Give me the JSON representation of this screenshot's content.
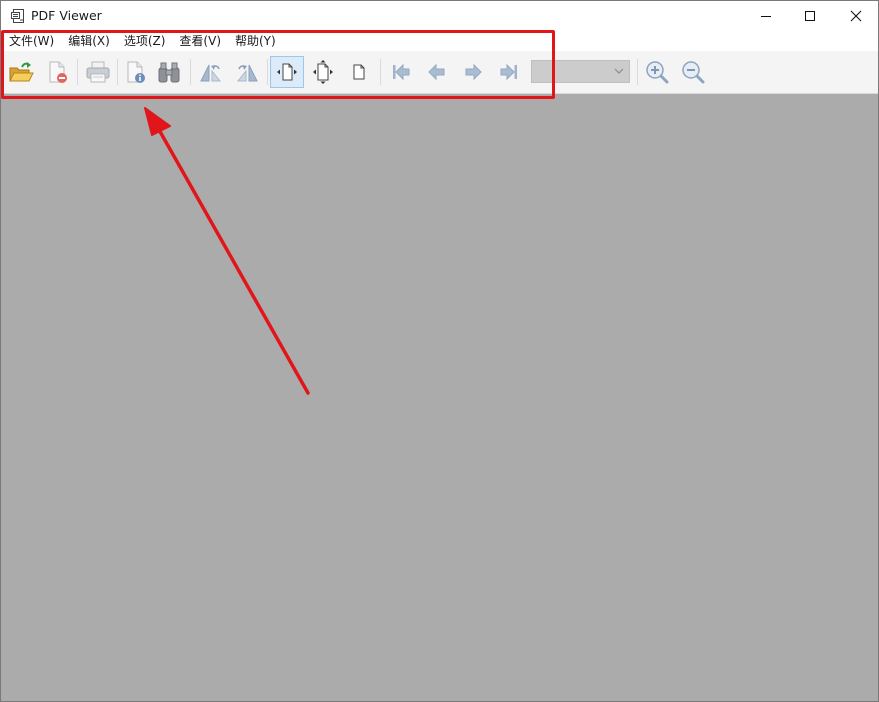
{
  "window": {
    "title": "PDF Viewer",
    "controls": {
      "minimize": "minimize-icon",
      "maximize": "maximize-icon",
      "close": "close-icon"
    }
  },
  "menubar": {
    "items": [
      {
        "label": "文件(W)"
      },
      {
        "label": "编辑(X)"
      },
      {
        "label": "选项(Z)"
      },
      {
        "label": "查看(V)"
      },
      {
        "label": "帮助(Y)"
      }
    ]
  },
  "toolbar": {
    "buttons": [
      {
        "icon": "open-folder-icon"
      },
      {
        "icon": "close-document-icon"
      },
      {
        "icon": "print-icon"
      },
      {
        "icon": "document-properties-icon"
      },
      {
        "icon": "binoculars-icon"
      },
      {
        "icon": "rotate-left-icon"
      },
      {
        "icon": "rotate-right-icon"
      },
      {
        "icon": "fit-width-icon",
        "active": true
      },
      {
        "icon": "fit-page-icon"
      },
      {
        "icon": "actual-size-icon"
      },
      {
        "icon": "first-page-icon"
      },
      {
        "icon": "previous-page-icon"
      },
      {
        "icon": "next-page-icon"
      },
      {
        "icon": "last-page-icon"
      },
      {
        "icon": "zoom-in-icon"
      },
      {
        "icon": "zoom-out-icon"
      }
    ],
    "page_select": {
      "value": ""
    }
  },
  "colors": {
    "content_background": "#ababab",
    "toolbar_background": "#f4f4f4",
    "annotation_red": "#e0161b",
    "active_button": "#dcebfa"
  }
}
